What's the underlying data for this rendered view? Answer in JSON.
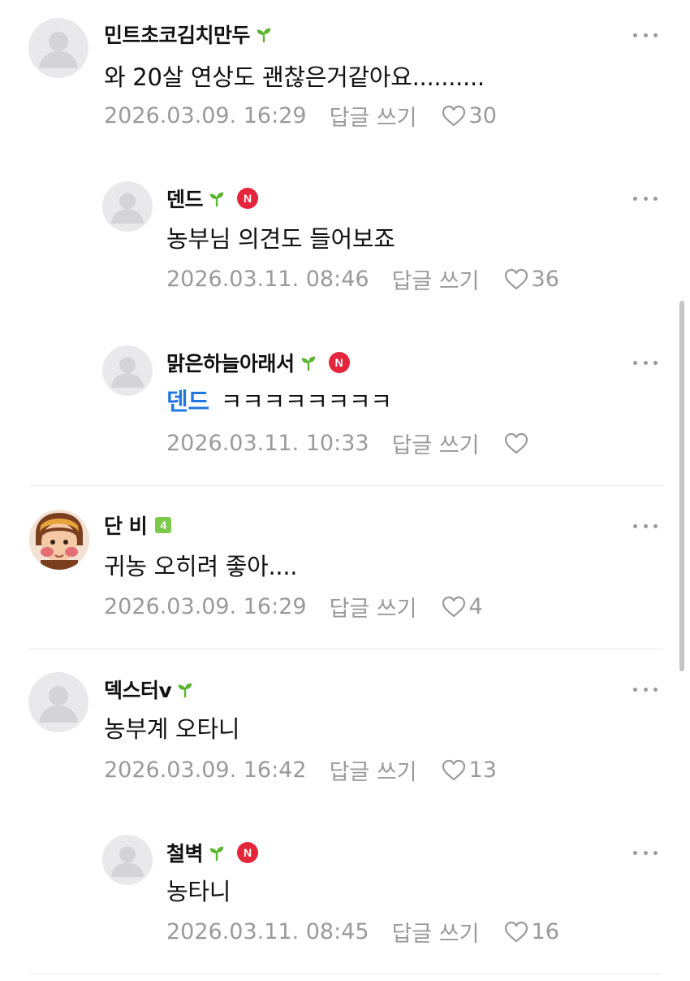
{
  "comments": [
    {
      "nickname": "민트초코김치만두",
      "content": "와 20살 연상도 괜찮은거같아요..........",
      "date": "2026.03.09. 16:29",
      "reply_label": "답글 쓰기",
      "likes": "30"
    },
    {
      "nickname": "덴드",
      "badge": "N",
      "content": "농부님 의견도 들어보죠",
      "date": "2026.03.11. 08:46",
      "reply_label": "답글 쓰기",
      "likes": "36"
    },
    {
      "nickname": "맑은하늘아래서",
      "badge": "N",
      "mention": "덴드",
      "content": "ㅋㅋㅋㅋㅋㅋㅋㅋ",
      "date": "2026.03.11. 10:33",
      "reply_label": "답글 쓰기",
      "likes": ""
    },
    {
      "nickname": "단 비",
      "level": "4",
      "content": "귀농 오히려 좋아....",
      "date": "2026.03.09. 16:29",
      "reply_label": "답글 쓰기",
      "likes": "4"
    },
    {
      "nickname": "덱스터v",
      "content": "농부계 오타니",
      "date": "2026.03.09. 16:42",
      "reply_label": "답글 쓰기",
      "likes": "13"
    },
    {
      "nickname": "철벽",
      "badge": "N",
      "content": "농타니",
      "date": "2026.03.11. 08:45",
      "reply_label": "답글 쓰기",
      "likes": "16"
    }
  ],
  "icons": {
    "sprout": "sprout-icon",
    "heart": "heart-outline-icon",
    "more": "more-horizontal-icon",
    "avatar_default": "default-user-avatar-icon"
  },
  "colors": {
    "sprout_green": "#5cb531",
    "new_badge_red": "#e5253b",
    "mention_blue": "#1f76e5",
    "meta_gray": "#9a9a9a"
  }
}
